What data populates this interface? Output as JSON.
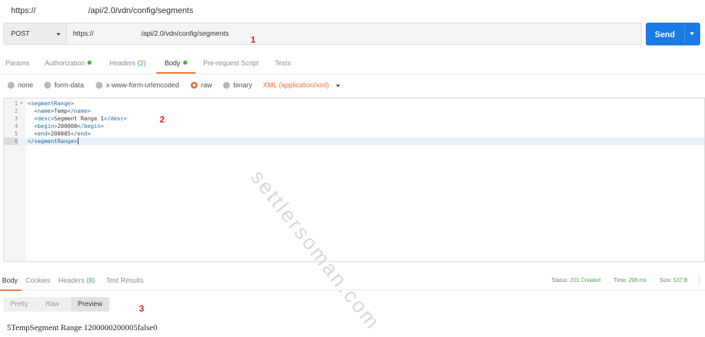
{
  "title_bar": {
    "scheme": "https://",
    "path": "/api/2.0/vdn/config/segments"
  },
  "request": {
    "method": "POST",
    "url_scheme": "https://",
    "url_path": "/api/2.0/vdn/config/segments",
    "send_label": "Send"
  },
  "annotations": {
    "a1": "1",
    "a2": "2",
    "a3": "3"
  },
  "tabs": {
    "params": "Params",
    "authorization": "Authorization",
    "headers": "Headers",
    "headers_count": "(2)",
    "body": "Body",
    "pre_request": "Pre-request Script",
    "tests": "Tests"
  },
  "body_options": {
    "none": "none",
    "form_data": "form-data",
    "urlencoded": "x-www-form-urlencoded",
    "raw": "raw",
    "binary": "binary",
    "selected_type": "XML (application/xml)"
  },
  "editor": {
    "lines": [
      {
        "num": "1",
        "open": "<segmentRange>",
        "text": "",
        "close": ""
      },
      {
        "num": "2",
        "open": "  <name>",
        "text": "Temp",
        "close": "</name>"
      },
      {
        "num": "3",
        "open": "  <desc>",
        "text": "Segment Range 1",
        "close": "</desc>"
      },
      {
        "num": "4",
        "open": "  <begin>",
        "text": "200000",
        "close": "</begin>"
      },
      {
        "num": "5",
        "open": "  <end>",
        "text": "200005",
        "close": "</end>"
      },
      {
        "num": "6",
        "open": "</segmentRange>",
        "text": "",
        "close": ""
      }
    ]
  },
  "watermark": "settlersoman.com",
  "response": {
    "tabs": {
      "body": "Body",
      "cookies": "Cookies",
      "headers": "Headers",
      "headers_count": "(8)",
      "test_results": "Test Results"
    },
    "status_label": "Status:",
    "status_value": "201 Created",
    "time_label": "Time:",
    "time_value": "298 ms",
    "size_label": "Size:",
    "size_value": "537 B",
    "formats": {
      "pretty": "Pretty",
      "raw": "Raw",
      "preview": "Preview"
    },
    "output": "5TempSegment Range 1200000200005false0"
  },
  "colors": {
    "accent": "#f26b3a",
    "send": "#1a7ae6",
    "success": "#3fa34d",
    "annotation": "#e02020"
  }
}
